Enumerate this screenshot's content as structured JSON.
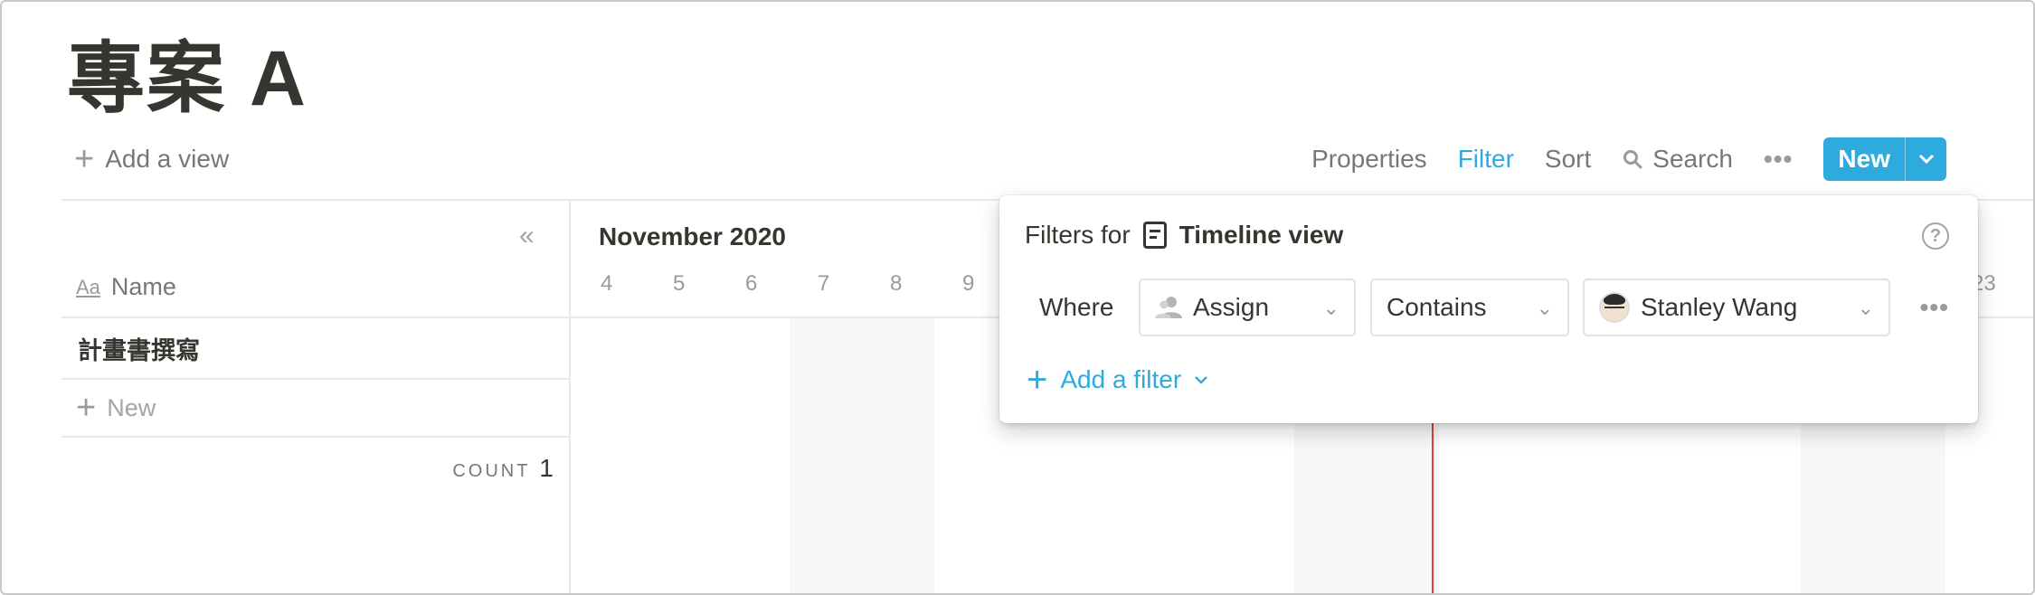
{
  "page": {
    "title": "專案 A"
  },
  "toolbar": {
    "add_view": "Add a view",
    "properties": "Properties",
    "filter": "Filter",
    "sort": "Sort",
    "search": "Search",
    "more": "•••",
    "new_label": "New",
    "new_caret": "⌄"
  },
  "table": {
    "collapse": "«",
    "name_header_icon": "Aa",
    "name_header": "Name",
    "rows": [
      "計畫書撰寫"
    ],
    "new_row": "New",
    "count_label": "COUNT",
    "count_value": "1"
  },
  "timeline": {
    "month": "November 2020",
    "days": [
      "4",
      "5",
      "6",
      "7",
      "8",
      "9",
      "23"
    ],
    "today_line_color": "#e03e3e"
  },
  "filter_popup": {
    "title_prefix": "Filters for",
    "view_name": "Timeline view",
    "view_icon": "document-icon",
    "help": "?",
    "where": "Where",
    "property": "Assign",
    "property_icon": "person-icon",
    "operator": "Contains",
    "value": "Stanley Wang",
    "value_icon": "avatar",
    "row_more": "•••",
    "add_filter": "Add a filter"
  },
  "colors": {
    "accent": "#2eaadc",
    "text": "#37352f",
    "muted": "#787774",
    "weekend_bg": "#f7f7f5",
    "today": "#e03e3e"
  }
}
